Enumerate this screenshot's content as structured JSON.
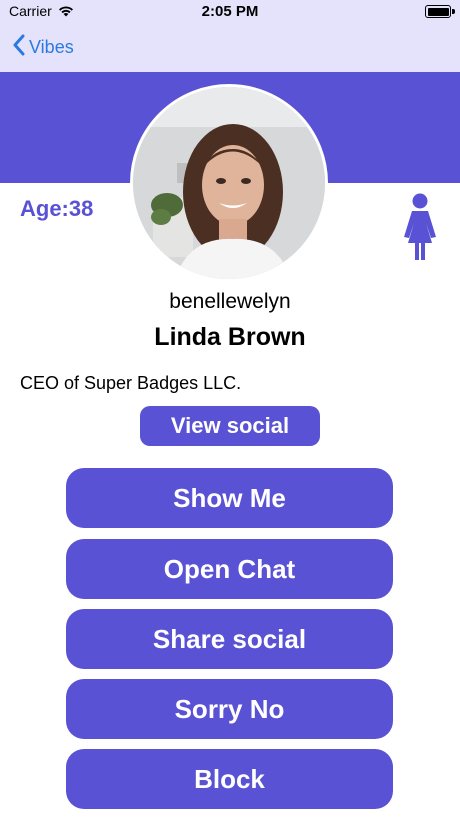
{
  "status_bar": {
    "carrier": "Carrier",
    "time": "2:05 PM",
    "wifi_icon": "wifi-icon",
    "battery_icon": "battery-icon"
  },
  "nav": {
    "back_label": "Vibes",
    "back_icon": "chevron-left-icon"
  },
  "profile": {
    "age_label": "Age:38",
    "gender_icon": "female-person-icon",
    "username": "benellewelyn",
    "full_name": "Linda Brown",
    "bio": "CEO of Super Badges LLC.",
    "view_social_label": "View social"
  },
  "actions": {
    "show_me": "Show Me",
    "open_chat": "Open Chat",
    "share_social": "Share social",
    "sorry_no": "Sorry No",
    "block": "Block"
  },
  "colors": {
    "accent": "#5A52D5",
    "nav_background": "#E4E3FB",
    "link": "#2A7AE2"
  }
}
